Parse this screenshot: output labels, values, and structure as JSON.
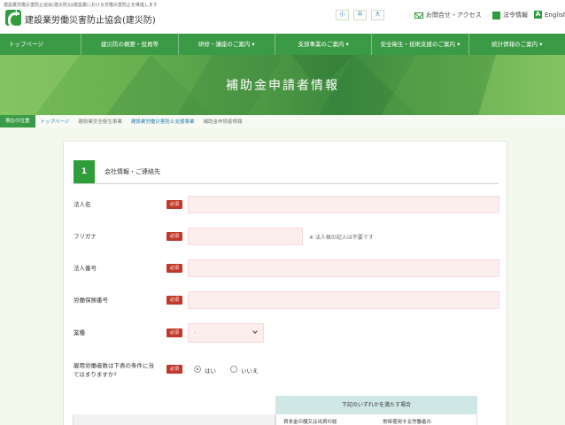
{
  "header": {
    "tagline": "建設業労働災害防止協会(建災防)は建設業における労働災害防止を推進します",
    "org_name": "建設業労働災害防止協会(建災防)",
    "font_size": {
      "small": "小",
      "medium": "中",
      "large": "大"
    },
    "links": {
      "contact": "お問合せ・アクセス",
      "disclosure": "法令情報",
      "english": "English"
    }
  },
  "nav": {
    "items": [
      "トップページ",
      "建災防の概要・役員等",
      "研修・講座のご案内 ▾",
      "支部事業のご案内 ▾",
      "安全衛生・技術支援のご案内 ▾",
      "統計情報のご案内 ▾"
    ]
  },
  "hero": {
    "title": "補助金申請者情報"
  },
  "breadcrumb": {
    "current_label": "現在の位置",
    "items": [
      "トップページ",
      "建設業安全衛生事業",
      "建設業労働災害防止支援事業",
      "補助金申請者情報"
    ]
  },
  "form": {
    "step": {
      "number": "1",
      "title": "会社情報・ご連絡先"
    },
    "required_label": "必須",
    "fields": {
      "company_name": {
        "label": "法人名",
        "value": ""
      },
      "furigana": {
        "label": "フリガナ",
        "value": "",
        "note": "※ 法人格の記入は不要です"
      },
      "corporate_number": {
        "label": "法人番号",
        "value": ""
      },
      "insurance_number": {
        "label": "労働保険番号",
        "value": ""
      },
      "industry": {
        "label": "業種",
        "selected": "-"
      },
      "condition_question": {
        "label_line1": "雇用労働者数は下表の条件に当",
        "label_line2": "てはまりますか?"
      }
    },
    "radio": {
      "yes": "はい",
      "no": "いいえ",
      "selected": "yes"
    },
    "conditions": {
      "heading": "下記のいずれかを満たす場合",
      "cell_a": "資本金の額又は出資の総",
      "cell_b": "常時使用する労働者の"
    }
  },
  "colors": {
    "brand_green": "#2f9e3a",
    "nav_green": "#3b9a45",
    "required_red": "#c0392b",
    "input_pink": "#fdeeee",
    "condition_head": "#cfe8e6"
  }
}
